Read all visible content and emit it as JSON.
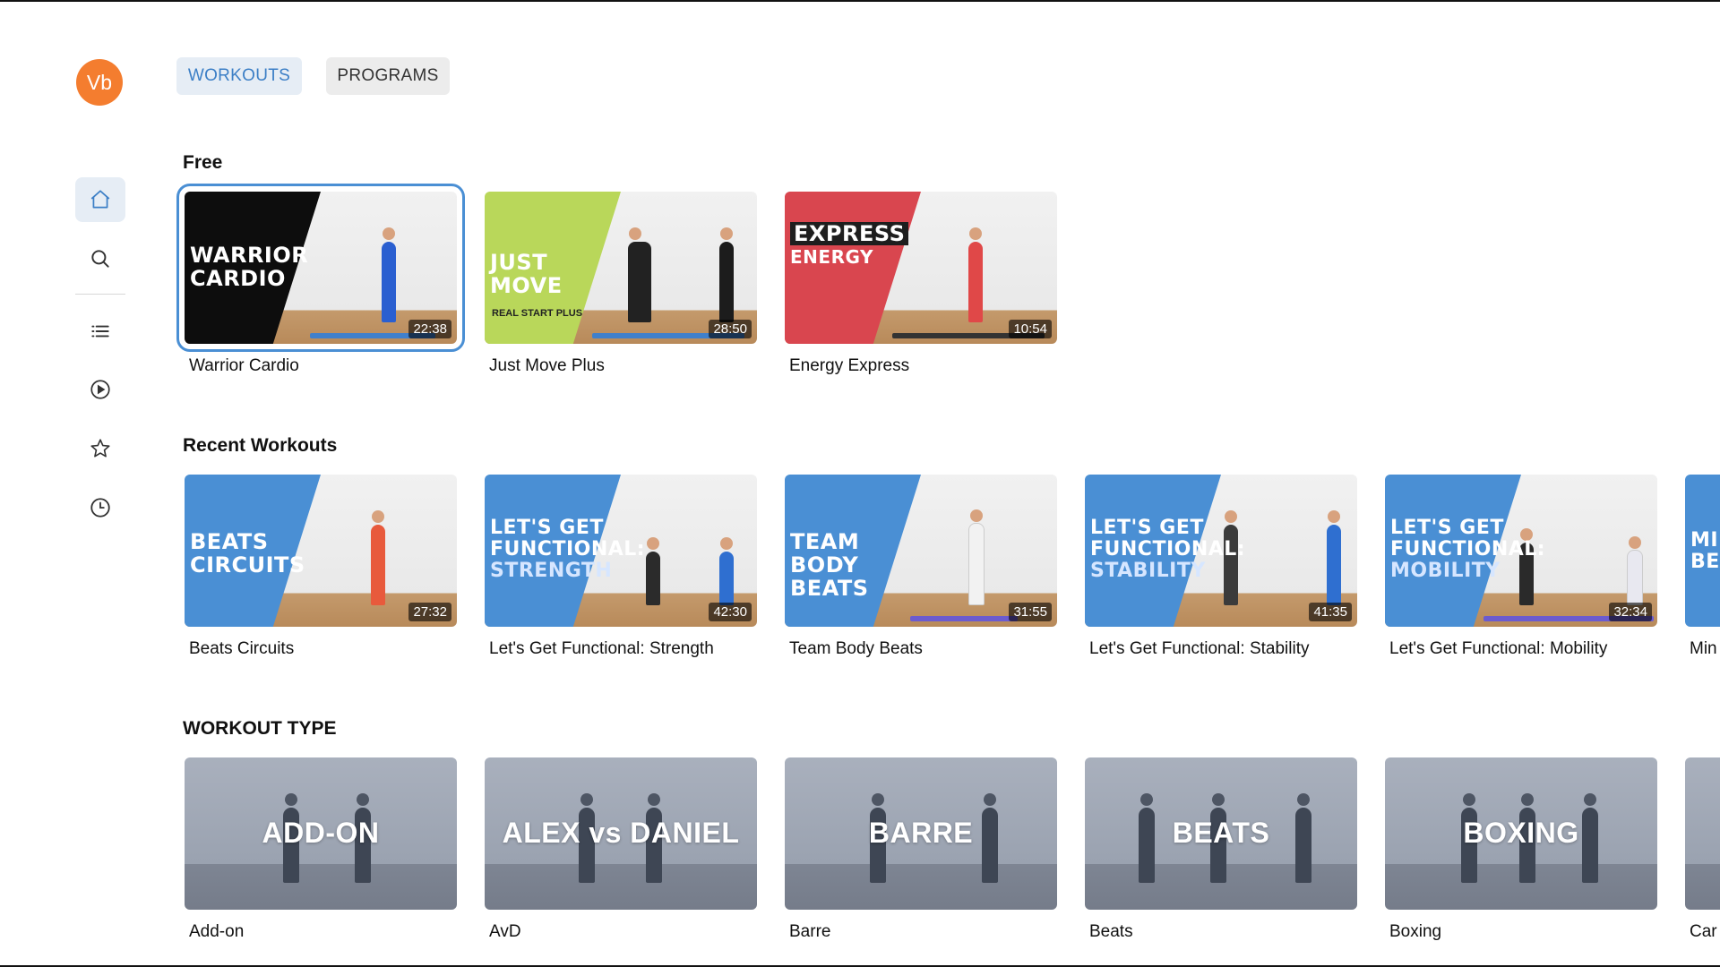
{
  "user": {
    "initials": "Vb"
  },
  "sidebar": {
    "icons": [
      "home-icon",
      "search-icon",
      "list-icon",
      "play-icon",
      "star-icon",
      "clock-icon"
    ],
    "active": "home"
  },
  "tabs": [
    {
      "label": "WORKOUTS",
      "active": true
    },
    {
      "label": "PROGRAMS",
      "active": false
    }
  ],
  "sections": {
    "free": {
      "title": "Free",
      "cards": [
        {
          "label": "Warrior Cardio",
          "duration": "22:38",
          "thumb_lines": [
            "WARRIOR",
            "CARDIO"
          ],
          "band_color": "#0d0d0d",
          "brand": ""
        },
        {
          "label": "Just Move Plus",
          "duration": "28:50",
          "thumb_lines": [
            "JUST MOVE"
          ],
          "band_color": "#b9d75a",
          "brand": "REAL START PLUS"
        },
        {
          "label": "Energy Express",
          "duration": "10:54",
          "thumb_lines": [
            "EXPRESS",
            "ENERGY"
          ],
          "band_color": "#d9464f",
          "brand": ""
        }
      ]
    },
    "recent": {
      "title": "Recent Workouts",
      "cards": [
        {
          "label": "Beats Circuits",
          "duration": "27:32",
          "thumb_lines": [
            "BEATS",
            "CIRCUITS"
          ]
        },
        {
          "label": "Let's Get Functional: Strength",
          "duration": "42:30",
          "thumb_lines": [
            "LET'S GET",
            "FUNCTIONAL:",
            "STRENGTH"
          ]
        },
        {
          "label": "Team Body Beats",
          "duration": "31:55",
          "thumb_lines": [
            "TEAM BODY",
            "BEATS"
          ]
        },
        {
          "label": "Let's Get Functional: Stability",
          "duration": "41:35",
          "thumb_lines": [
            "LET'S GET",
            "FUNCTIONAL:",
            "STABILITY"
          ]
        },
        {
          "label": "Let's Get Functional: Mobility",
          "duration": "32:34",
          "thumb_lines": [
            "LET'S GET",
            "FUNCTIONAL:",
            "MOBILITY"
          ]
        },
        {
          "label": "Min",
          "duration": "",
          "thumb_lines": [
            "MIN",
            "BEA"
          ]
        }
      ]
    },
    "types": {
      "title": "WORKOUT TYPE",
      "cards": [
        {
          "label": "Add-on",
          "thumb_title": "ADD-ON"
        },
        {
          "label": "AvD",
          "thumb_title": "ALEX vs DANIEL"
        },
        {
          "label": "Barre",
          "thumb_title": "BARRE"
        },
        {
          "label": "Beats",
          "thumb_title": "BEATS"
        },
        {
          "label": "Boxing",
          "thumb_title": "BOXING"
        },
        {
          "label": "Car",
          "thumb_title": ""
        }
      ]
    }
  },
  "colors": {
    "accent": "#3c7fc6",
    "avatar": "#f47d2f",
    "band_blue": "#4a8fd4"
  }
}
